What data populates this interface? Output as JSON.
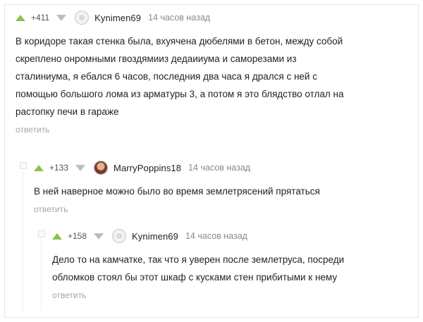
{
  "comments": [
    {
      "rating": "+411",
      "username": "Kynimen69",
      "time": "14 часов назад",
      "lines": [
        "В коридоре такая стенка была, вхуячена дюбелями в бетон, между собой",
        "скреплено онромными гвоздямииз дедаииума и саморезами из",
        "сталиниума, я ебался 6 часов, последния два часа я дрался с ней с",
        "помощью большого лома из арматуры 3, а потом я это блядство отлал на",
        "растопку печи в гараже"
      ],
      "reply": "ответить"
    },
    {
      "rating": "+133",
      "username": "MarryPoppins18",
      "time": "14 часов назад",
      "lines": [
        "В ней наверное можно было во время землетрясений прятаться"
      ],
      "reply": "ответить"
    },
    {
      "rating": "+158",
      "username": "Kynimen69",
      "time": "14 часов назад",
      "lines": [
        "Дело то на камчатке, так что я уверен после землетруса, посреди",
        "обломков стоял бы этот шкаф с кусками стен прибитыми к нему"
      ],
      "reply": "ответить"
    }
  ],
  "colors": {
    "upvote": "#8bc34a",
    "downvote": "#bdbdbd",
    "reply": "#a5a5a5",
    "time": "#8a8a8a"
  },
  "icons": {
    "upvote": "upvote-arrow-icon",
    "downvote": "downvote-arrow-icon",
    "avatar_default": "user-avatar-icon"
  }
}
